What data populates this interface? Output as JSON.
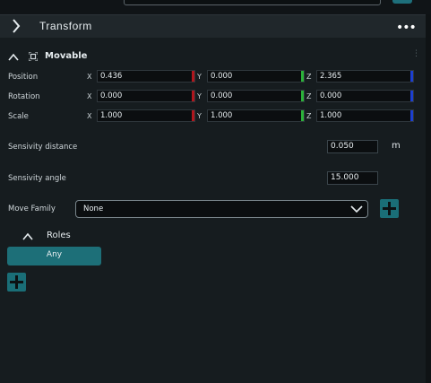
{
  "section": {
    "title": "Transform",
    "more_label": "•••"
  },
  "component": {
    "title": "Movable",
    "kebab": "⋮"
  },
  "transform_rows": [
    {
      "label": "Position",
      "x": "0.436",
      "y": "0.000",
      "z": "2.365"
    },
    {
      "label": "Rotation",
      "x": "0.000",
      "y": "0.000",
      "z": "0.000"
    },
    {
      "label": "Scale",
      "x": "1.000",
      "y": "1.000",
      "z": "1.000"
    }
  ],
  "axes": {
    "x": "X",
    "y": "Y",
    "z": "Z"
  },
  "axis_colors": {
    "x": "#b1161d",
    "y": "#2bb23a",
    "z": "#1c3fd0"
  },
  "sensitivity_distance": {
    "label": "Sensivity distance",
    "value": "0.050",
    "unit": "m"
  },
  "sensitivity_angle": {
    "label": "Sensivity angle",
    "value": "15.000"
  },
  "move_family": {
    "label": "Move Family",
    "selected": "None"
  },
  "roles": {
    "title": "Roles",
    "any_label": "Any"
  },
  "colors": {
    "accent": "#1d6f78",
    "background": "#161c1f",
    "header": "#20272b"
  }
}
